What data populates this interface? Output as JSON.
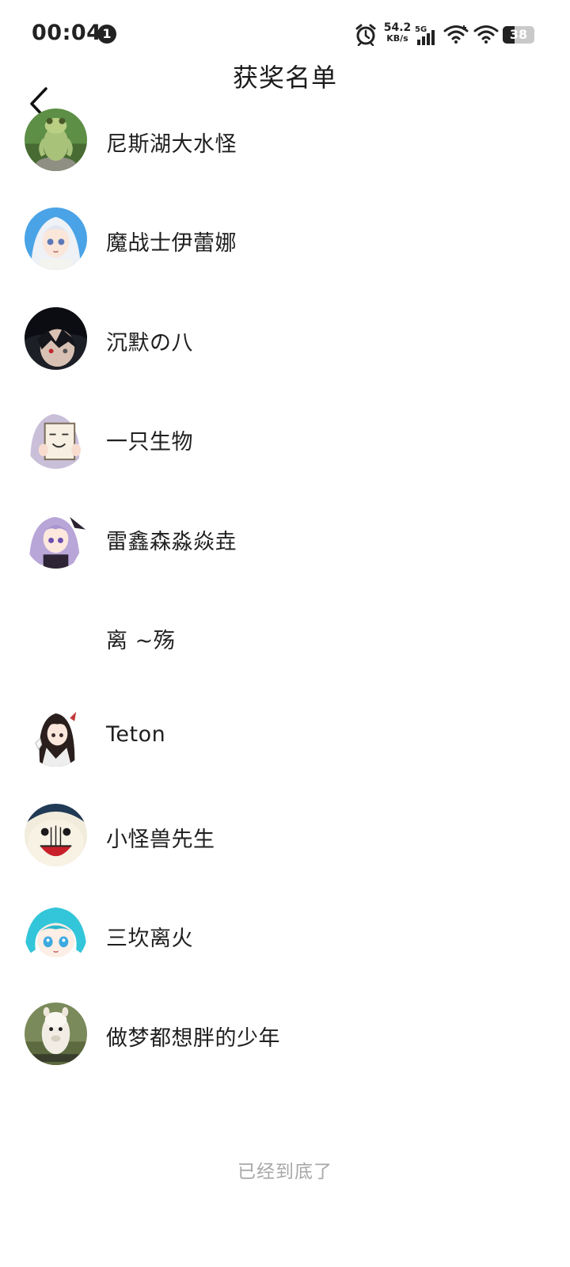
{
  "status_bar": {
    "time": "00:04",
    "notification_count": "1",
    "net_speed_value": "54.2",
    "net_speed_unit": "KB/s",
    "network_type": "5G",
    "battery_level": "38",
    "battery_fraction": 0.38
  },
  "header": {
    "title": "获奖名单",
    "back_icon": "chevron-left-icon"
  },
  "winners": [
    {
      "name": "尼斯湖大水怪",
      "avatar": "frog-avatar"
    },
    {
      "name": "魔战士伊蕾娜",
      "avatar": "anime-girl-white-hair-avatar"
    },
    {
      "name": "沉默の八",
      "avatar": "dark-hair-character-avatar"
    },
    {
      "name": "一只生物",
      "avatar": "meme-sign-avatar"
    },
    {
      "name": "雷鑫森淼焱垚",
      "avatar": "anime-girl-purple-avatar"
    },
    {
      "name": "离 ~殇",
      "avatar": ""
    },
    {
      "name": "Teton",
      "avatar": "anime-girl-black-hair-avatar"
    },
    {
      "name": "小怪兽先生",
      "avatar": "meme-noodle-avatar"
    },
    {
      "name": "三坎离火",
      "avatar": "anime-girl-cyan-hair-avatar"
    },
    {
      "name": "做梦都想胖的少年",
      "avatar": "alpaca-avatar"
    }
  ],
  "footer": {
    "end_text": "已经到底了"
  }
}
